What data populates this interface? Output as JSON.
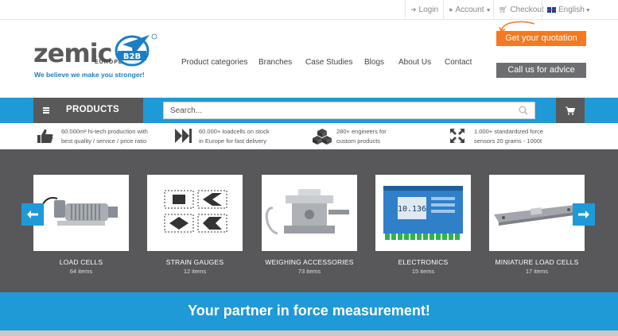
{
  "topbar": {
    "login_label": "Login",
    "account_label": "Account",
    "checkout_label": "Checkout",
    "language_label": "English"
  },
  "logo": {
    "brand": "zemic",
    "region": "EUROPE",
    "badge": "B2B",
    "tagline": "We believe we make you stronger!"
  },
  "nav": {
    "items": [
      "Product categories",
      "Branches",
      "Case Studies",
      "Blogs",
      "About Us",
      "Contact"
    ]
  },
  "cta": {
    "quotation_label": "Get your quotation",
    "advice_label": "Call us for advice"
  },
  "toolbar": {
    "products_label": "PRODUCTS",
    "search_placeholder": "Search..."
  },
  "usps": [
    {
      "line1": "60.000m² hi-tech production with",
      "line2": "best quality / service / price ratio",
      "icon": "thumbs-up-icon"
    },
    {
      "line1": "60.000+ loadcells on stock",
      "line2": "in Europe for fast delivery",
      "icon": "fast-forward-icon"
    },
    {
      "line1": "280+ engineers for",
      "line2": "custom products",
      "icon": "cubes-icon"
    },
    {
      "line1": "1.000+ standardized force",
      "line2": "sensors 20 grams - 1000t",
      "icon": "expand-arrows-icon"
    }
  ],
  "categories": [
    {
      "title": "LOAD CELLS",
      "count": "64 items"
    },
    {
      "title": "STRAIN GAUGES",
      "count": "12 items"
    },
    {
      "title": "WEIGHING ACCESSORIES",
      "count": "73 items"
    },
    {
      "title": "ELECTRONICS",
      "count": "15 items"
    },
    {
      "title": "MINIATURE LOAD CELLS",
      "count": "17 items"
    }
  ],
  "banner": {
    "text": "Your partner in force measurement!"
  },
  "colors": {
    "accent_blue": "#1f9ad6",
    "accent_orange": "#f47920",
    "dark_gray": "#58585a"
  }
}
